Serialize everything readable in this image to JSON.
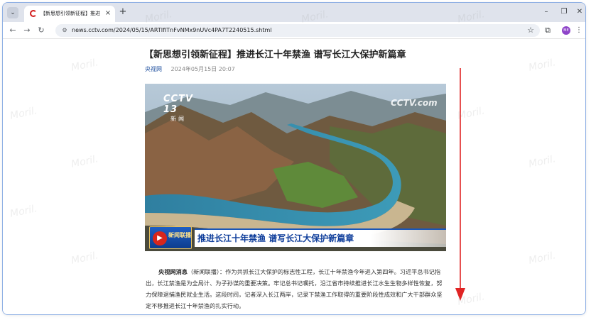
{
  "browser": {
    "tab": {
      "title": "【新思想引领新征程】推进长江",
      "close": "×"
    },
    "new_tab": "+",
    "url": "news.cctv.com/2024/05/15/ARTIfITnFvNMx9nUVc4PA7T2240515.shtml",
    "window_controls": {
      "minimize": "–",
      "maximize": "❐",
      "close": "✕"
    },
    "profile_initials": "ME"
  },
  "article": {
    "headline": "【新思想引领新征程】推进长江十年禁渔 谱写长江大保护新篇章",
    "source": "央视网",
    "date": "2024年05月15日 20:07",
    "hero": {
      "channel_logo": "CCTV 13",
      "channel_sub": "新闻",
      "watermark": "CCTV.com",
      "program_logo": "新闻联播",
      "caption": "推进长江十年禁渔 谱写长江大保护新篇章"
    },
    "lead_label": "央视网消息",
    "lead_source": "（新闻联播）：",
    "body": "作为共抓长江大保护的标志性工程，长江十年禁渔今年进入第四年。习近平总书记指出，长江禁渔是为全局计、为子孙谋的重要决策。牢记总书记嘱托，沿江省市持续推进长江水生生物多样性恢复，努力保障退捕渔民就业生活。这段时间，记者深入长江两岸，记录下禁渔工作取得的重要阶段性成效和广大干部群众坚定不移推进长江十年禁渔的扎实行动。"
  },
  "watermark_text": "Moril.",
  "colors": {
    "accent_blue": "#1d4e9e",
    "arrow_red": "#e02424",
    "cctv_red": "#d21a1a"
  }
}
